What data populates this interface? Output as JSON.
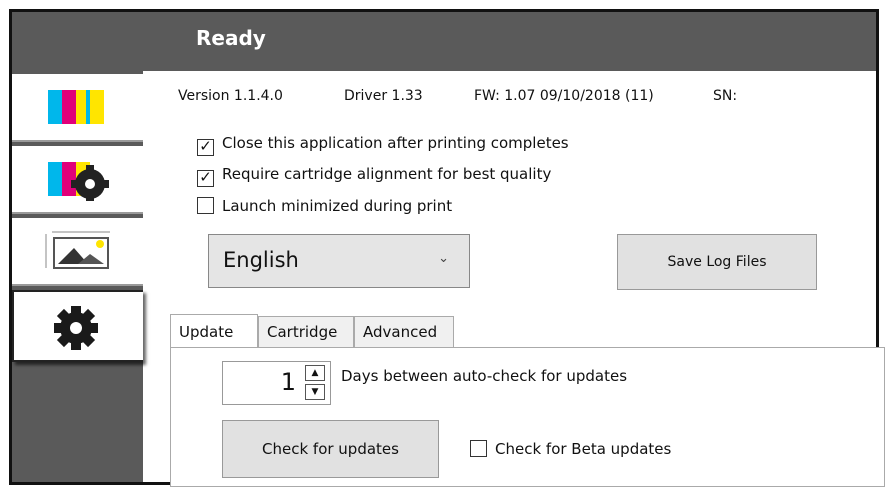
{
  "window": {
    "title": "Ready"
  },
  "sidebar": {
    "items": [
      {
        "icon": "color-bars-icon"
      },
      {
        "icon": "color-settings-icon"
      },
      {
        "icon": "image-layout-icon"
      },
      {
        "icon": "gear-icon"
      }
    ]
  },
  "info": {
    "version": "Version 1.1.4.0",
    "driver": "Driver 1.33",
    "firmware": "FW: 1.07 09/10/2018 (11)",
    "serial_label": "SN:"
  },
  "options": [
    {
      "label": "Close this application after printing completes",
      "checked": true
    },
    {
      "label": "Require cartridge alignment for best quality",
      "checked": true
    },
    {
      "label": "Launch minimized during print",
      "checked": false
    }
  ],
  "language": {
    "selected": "English"
  },
  "buttons": {
    "save_log": "Save Log Files",
    "check_updates": "Check for updates"
  },
  "tabs": [
    "Update",
    "Cartridge",
    "Advanced"
  ],
  "update": {
    "days_value": "1",
    "days_label": "Days between auto-check for updates",
    "beta_label": "Check for Beta updates",
    "beta_checked": false
  },
  "colors": {
    "chrome": "#5a5a5a",
    "cyan": "#00b7eb",
    "magenta": "#e0007a",
    "yellow": "#ffe500"
  }
}
